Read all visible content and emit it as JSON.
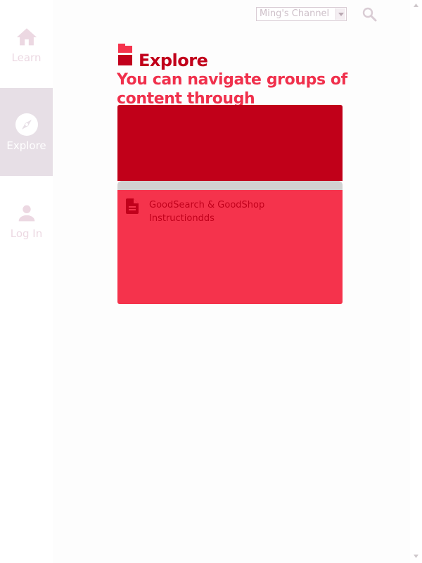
{
  "nav": {
    "items": [
      {
        "label": "Learn",
        "icon": "home-icon"
      },
      {
        "label": "Explore",
        "icon": "compass-icon",
        "active": true
      },
      {
        "label": "Log In",
        "icon": "person-icon"
      }
    ]
  },
  "header": {
    "channel_select": {
      "value": "Ming's Channel"
    },
    "search_icon": "search-icon"
  },
  "main": {
    "title": "Explore",
    "title_icon": "topic-icon",
    "description": "You can navigate groups of content through"
  },
  "card": {
    "title": "GoodSearch & GoodShop Instructiondds",
    "icon": "document-icon"
  },
  "colors": {
    "primary": "#c1001b",
    "accent": "#f5334c",
    "nav_active_bg": "#e7dfe6",
    "nav_inactive": "#ecd8e2"
  }
}
